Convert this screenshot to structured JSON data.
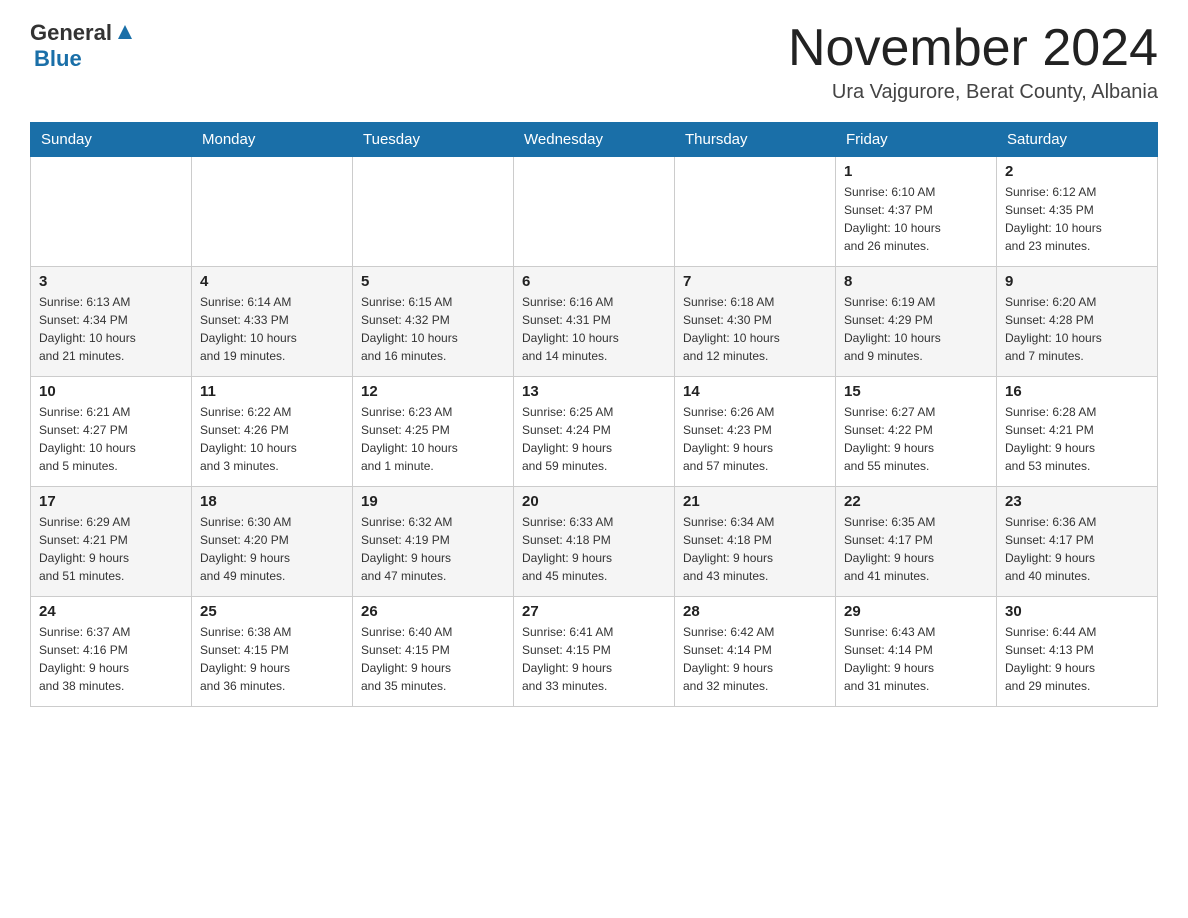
{
  "header": {
    "logo_general": "General",
    "logo_blue": "Blue",
    "month_title": "November 2024",
    "location": "Ura Vajgurore, Berat County, Albania"
  },
  "weekdays": [
    "Sunday",
    "Monday",
    "Tuesday",
    "Wednesday",
    "Thursday",
    "Friday",
    "Saturday"
  ],
  "weeks": [
    [
      {
        "day": "",
        "info": ""
      },
      {
        "day": "",
        "info": ""
      },
      {
        "day": "",
        "info": ""
      },
      {
        "day": "",
        "info": ""
      },
      {
        "day": "",
        "info": ""
      },
      {
        "day": "1",
        "info": "Sunrise: 6:10 AM\nSunset: 4:37 PM\nDaylight: 10 hours\nand 26 minutes."
      },
      {
        "day": "2",
        "info": "Sunrise: 6:12 AM\nSunset: 4:35 PM\nDaylight: 10 hours\nand 23 minutes."
      }
    ],
    [
      {
        "day": "3",
        "info": "Sunrise: 6:13 AM\nSunset: 4:34 PM\nDaylight: 10 hours\nand 21 minutes."
      },
      {
        "day": "4",
        "info": "Sunrise: 6:14 AM\nSunset: 4:33 PM\nDaylight: 10 hours\nand 19 minutes."
      },
      {
        "day": "5",
        "info": "Sunrise: 6:15 AM\nSunset: 4:32 PM\nDaylight: 10 hours\nand 16 minutes."
      },
      {
        "day": "6",
        "info": "Sunrise: 6:16 AM\nSunset: 4:31 PM\nDaylight: 10 hours\nand 14 minutes."
      },
      {
        "day": "7",
        "info": "Sunrise: 6:18 AM\nSunset: 4:30 PM\nDaylight: 10 hours\nand 12 minutes."
      },
      {
        "day": "8",
        "info": "Sunrise: 6:19 AM\nSunset: 4:29 PM\nDaylight: 10 hours\nand 9 minutes."
      },
      {
        "day": "9",
        "info": "Sunrise: 6:20 AM\nSunset: 4:28 PM\nDaylight: 10 hours\nand 7 minutes."
      }
    ],
    [
      {
        "day": "10",
        "info": "Sunrise: 6:21 AM\nSunset: 4:27 PM\nDaylight: 10 hours\nand 5 minutes."
      },
      {
        "day": "11",
        "info": "Sunrise: 6:22 AM\nSunset: 4:26 PM\nDaylight: 10 hours\nand 3 minutes."
      },
      {
        "day": "12",
        "info": "Sunrise: 6:23 AM\nSunset: 4:25 PM\nDaylight: 10 hours\nand 1 minute."
      },
      {
        "day": "13",
        "info": "Sunrise: 6:25 AM\nSunset: 4:24 PM\nDaylight: 9 hours\nand 59 minutes."
      },
      {
        "day": "14",
        "info": "Sunrise: 6:26 AM\nSunset: 4:23 PM\nDaylight: 9 hours\nand 57 minutes."
      },
      {
        "day": "15",
        "info": "Sunrise: 6:27 AM\nSunset: 4:22 PM\nDaylight: 9 hours\nand 55 minutes."
      },
      {
        "day": "16",
        "info": "Sunrise: 6:28 AM\nSunset: 4:21 PM\nDaylight: 9 hours\nand 53 minutes."
      }
    ],
    [
      {
        "day": "17",
        "info": "Sunrise: 6:29 AM\nSunset: 4:21 PM\nDaylight: 9 hours\nand 51 minutes."
      },
      {
        "day": "18",
        "info": "Sunrise: 6:30 AM\nSunset: 4:20 PM\nDaylight: 9 hours\nand 49 minutes."
      },
      {
        "day": "19",
        "info": "Sunrise: 6:32 AM\nSunset: 4:19 PM\nDaylight: 9 hours\nand 47 minutes."
      },
      {
        "day": "20",
        "info": "Sunrise: 6:33 AM\nSunset: 4:18 PM\nDaylight: 9 hours\nand 45 minutes."
      },
      {
        "day": "21",
        "info": "Sunrise: 6:34 AM\nSunset: 4:18 PM\nDaylight: 9 hours\nand 43 minutes."
      },
      {
        "day": "22",
        "info": "Sunrise: 6:35 AM\nSunset: 4:17 PM\nDaylight: 9 hours\nand 41 minutes."
      },
      {
        "day": "23",
        "info": "Sunrise: 6:36 AM\nSunset: 4:17 PM\nDaylight: 9 hours\nand 40 minutes."
      }
    ],
    [
      {
        "day": "24",
        "info": "Sunrise: 6:37 AM\nSunset: 4:16 PM\nDaylight: 9 hours\nand 38 minutes."
      },
      {
        "day": "25",
        "info": "Sunrise: 6:38 AM\nSunset: 4:15 PM\nDaylight: 9 hours\nand 36 minutes."
      },
      {
        "day": "26",
        "info": "Sunrise: 6:40 AM\nSunset: 4:15 PM\nDaylight: 9 hours\nand 35 minutes."
      },
      {
        "day": "27",
        "info": "Sunrise: 6:41 AM\nSunset: 4:15 PM\nDaylight: 9 hours\nand 33 minutes."
      },
      {
        "day": "28",
        "info": "Sunrise: 6:42 AM\nSunset: 4:14 PM\nDaylight: 9 hours\nand 32 minutes."
      },
      {
        "day": "29",
        "info": "Sunrise: 6:43 AM\nSunset: 4:14 PM\nDaylight: 9 hours\nand 31 minutes."
      },
      {
        "day": "30",
        "info": "Sunrise: 6:44 AM\nSunset: 4:13 PM\nDaylight: 9 hours\nand 29 minutes."
      }
    ]
  ]
}
